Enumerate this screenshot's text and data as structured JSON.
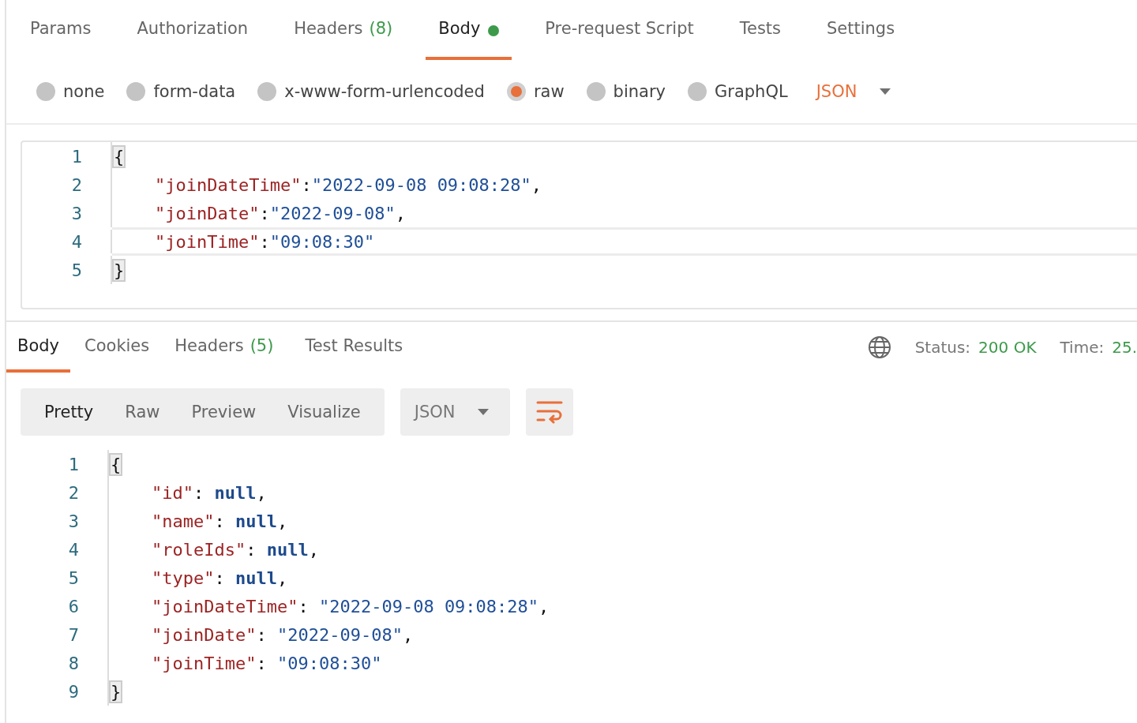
{
  "request_tabs": [
    {
      "label": "Params",
      "selected": false
    },
    {
      "label": "Authorization",
      "selected": false
    },
    {
      "label": "Headers",
      "count": "(8)",
      "selected": false
    },
    {
      "label": "Body",
      "indicator": true,
      "selected": true
    },
    {
      "label": "Pre-request Script",
      "selected": false
    },
    {
      "label": "Tests",
      "selected": false
    },
    {
      "label": "Settings",
      "selected": false
    }
  ],
  "body_types": [
    {
      "label": "none",
      "selected": false
    },
    {
      "label": "form-data",
      "selected": false
    },
    {
      "label": "x-www-form-urlencoded",
      "selected": false
    },
    {
      "label": "raw",
      "selected": true
    },
    {
      "label": "binary",
      "selected": false
    },
    {
      "label": "GraphQL",
      "selected": false
    }
  ],
  "raw_format": "JSON",
  "request_editor": [
    {
      "number": "1",
      "indented": false,
      "active": false,
      "tokens": [
        {
          "kind": "bracket",
          "text": "{"
        }
      ]
    },
    {
      "number": "2",
      "indented": true,
      "active": false,
      "tokens": [
        {
          "kind": "key",
          "text": "\"joinDateTime\""
        },
        {
          "kind": "punct",
          "text": ":"
        },
        {
          "kind": "string",
          "text": "\"2022-09-08 09:08:28\""
        },
        {
          "kind": "punct",
          "text": ","
        }
      ]
    },
    {
      "number": "3",
      "indented": true,
      "active": false,
      "tokens": [
        {
          "kind": "key",
          "text": "\"joinDate\""
        },
        {
          "kind": "punct",
          "text": ":"
        },
        {
          "kind": "string",
          "text": "\"2022-09-08\""
        },
        {
          "kind": "punct",
          "text": ","
        }
      ]
    },
    {
      "number": "4",
      "indented": true,
      "active": true,
      "tokens": [
        {
          "kind": "key",
          "text": "\"joinTime\""
        },
        {
          "kind": "punct",
          "text": ":"
        },
        {
          "kind": "string",
          "text": "\"09:08:30\""
        }
      ]
    },
    {
      "number": "5",
      "indented": false,
      "active": false,
      "tokens": [
        {
          "kind": "bracket",
          "text": "}"
        }
      ]
    }
  ],
  "response_tabs": [
    {
      "label": "Body",
      "selected": true
    },
    {
      "label": "Cookies",
      "selected": false
    },
    {
      "label": "Headers",
      "count": "(5)",
      "selected": false
    },
    {
      "label": "Test Results",
      "selected": false
    }
  ],
  "status": {
    "status_label": "Status:",
    "status_value": "200 OK",
    "time_label": "Time:",
    "time_value": "25."
  },
  "view_modes": [
    {
      "label": "Pretty",
      "selected": true
    },
    {
      "label": "Raw",
      "selected": false
    },
    {
      "label": "Preview",
      "selected": false
    },
    {
      "label": "Visualize",
      "selected": false
    }
  ],
  "response_format": "JSON",
  "response_body": [
    {
      "number": "1",
      "indented": false,
      "tokens": [
        {
          "kind": "bracket",
          "text": "{"
        }
      ]
    },
    {
      "number": "2",
      "indented": true,
      "tokens": [
        {
          "kind": "key",
          "text": "\"id\""
        },
        {
          "kind": "punct",
          "text": ": "
        },
        {
          "kind": "null",
          "text": "null"
        },
        {
          "kind": "punct",
          "text": ","
        }
      ]
    },
    {
      "number": "3",
      "indented": true,
      "tokens": [
        {
          "kind": "key",
          "text": "\"name\""
        },
        {
          "kind": "punct",
          "text": ": "
        },
        {
          "kind": "null",
          "text": "null"
        },
        {
          "kind": "punct",
          "text": ","
        }
      ]
    },
    {
      "number": "4",
      "indented": true,
      "tokens": [
        {
          "kind": "key",
          "text": "\"roleIds\""
        },
        {
          "kind": "punct",
          "text": ": "
        },
        {
          "kind": "null",
          "text": "null"
        },
        {
          "kind": "punct",
          "text": ","
        }
      ]
    },
    {
      "number": "5",
      "indented": true,
      "tokens": [
        {
          "kind": "key",
          "text": "\"type\""
        },
        {
          "kind": "punct",
          "text": ": "
        },
        {
          "kind": "null",
          "text": "null"
        },
        {
          "kind": "punct",
          "text": ","
        }
      ]
    },
    {
      "number": "6",
      "indented": true,
      "tokens": [
        {
          "kind": "key",
          "text": "\"joinDateTime\""
        },
        {
          "kind": "punct",
          "text": ": "
        },
        {
          "kind": "string",
          "text": "\"2022-09-08 09:08:28\""
        },
        {
          "kind": "punct",
          "text": ","
        }
      ]
    },
    {
      "number": "7",
      "indented": true,
      "tokens": [
        {
          "kind": "key",
          "text": "\"joinDate\""
        },
        {
          "kind": "punct",
          "text": ": "
        },
        {
          "kind": "string",
          "text": "\"2022-09-08\""
        },
        {
          "kind": "punct",
          "text": ","
        }
      ]
    },
    {
      "number": "8",
      "indented": true,
      "tokens": [
        {
          "kind": "key",
          "text": "\"joinTime\""
        },
        {
          "kind": "punct",
          "text": ": "
        },
        {
          "kind": "string",
          "text": "\"09:08:30\""
        }
      ]
    },
    {
      "number": "9",
      "indented": false,
      "tokens": [
        {
          "kind": "bracket",
          "text": "}"
        }
      ]
    }
  ]
}
